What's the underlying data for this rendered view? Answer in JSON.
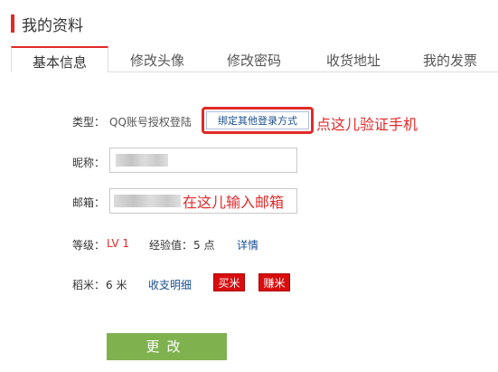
{
  "page": {
    "title": "我的资料"
  },
  "tabs": [
    {
      "label": "基本信息",
      "active": true
    },
    {
      "label": "修改头像"
    },
    {
      "label": "修改密码"
    },
    {
      "label": "收货地址"
    },
    {
      "label": "我的发票"
    }
  ],
  "form": {
    "type": {
      "label": "类型：",
      "value": "QQ账号授权登陆",
      "bind_button": "绑定其他登录方式",
      "annotation": "点这儿验证手机"
    },
    "nickname": {
      "label": "昵称："
    },
    "email": {
      "label": "邮箱：",
      "annotation": "在这儿输入邮箱"
    },
    "level": {
      "label": "等级：",
      "value": "LV 1",
      "exp_label": "经验值：",
      "exp_value": "5 点",
      "details_link": "详情"
    },
    "rice": {
      "label": "稻米：",
      "value": "6 米",
      "detail_link": "收支明细",
      "buy_button": "买米",
      "earn_button": "赚米"
    },
    "submit_label": "更改"
  },
  "colors": {
    "accent": "#e12a2a",
    "link": "#1a4f8f",
    "submit": "#7fb24f",
    "red_button": "#d80d0d"
  }
}
